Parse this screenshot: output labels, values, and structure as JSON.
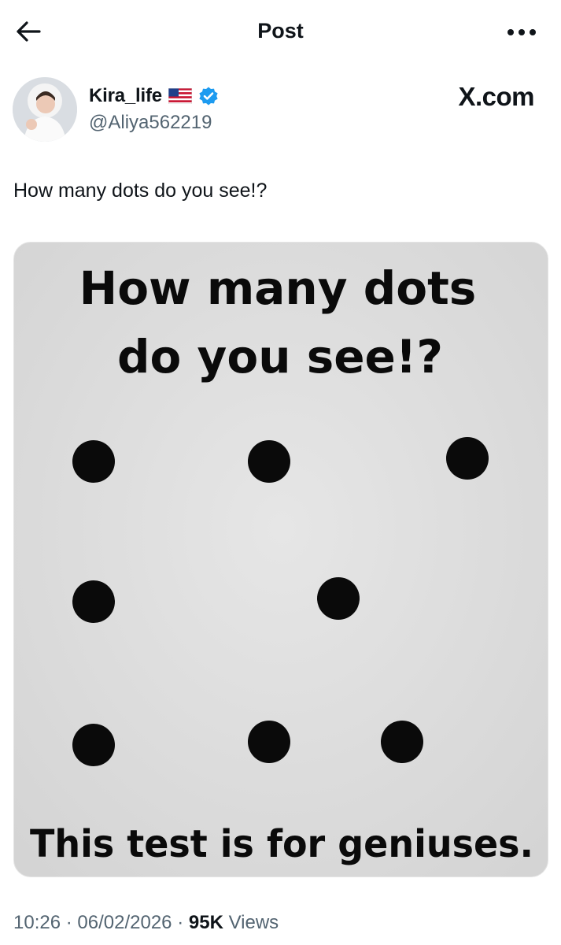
{
  "topbar": {
    "title": "Post"
  },
  "post": {
    "author": {
      "display_name": "Kira_life",
      "handle": "@Aliya562219"
    },
    "watermark": "X.com",
    "text": "How many dots do you see!?",
    "image": {
      "heading_line1": "How many dots",
      "heading_line2": "do you see!?",
      "footer": "This test is for geniuses.",
      "dot_count_visible": 8
    },
    "meta": {
      "time": "10:26",
      "date": "06/02/2026",
      "views_count": "95K",
      "views_label": "Views",
      "separator": "·"
    }
  },
  "icons": {
    "back": "arrow-left-icon",
    "more": "more-horizontal-icon",
    "flag": "us-flag-icon",
    "verified": "verified-badge-icon"
  },
  "colors": {
    "text_primary": "#0f1419",
    "text_secondary": "#536471",
    "verified_blue": "#1d9bf0",
    "media_background": "#dfdfdf"
  }
}
